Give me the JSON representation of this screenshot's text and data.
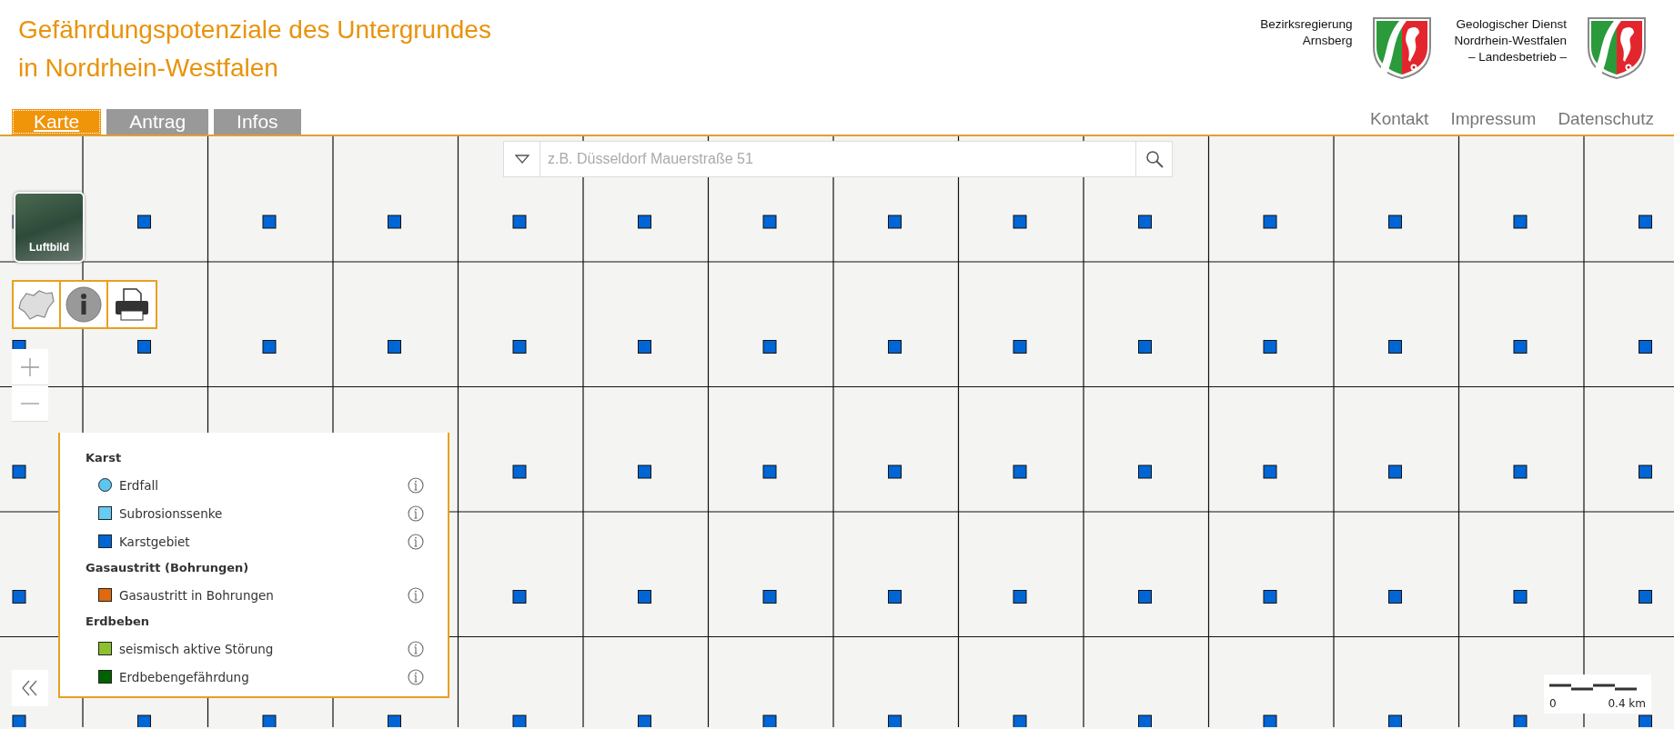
{
  "header": {
    "title_lines": [
      "Gefährdungspotenziale des Untergrundes",
      "in Nordrhein-Westfalen"
    ],
    "organizations": [
      {
        "lines": [
          "Bezirksregierung",
          "Arnsberg"
        ]
      },
      {
        "lines": [
          "Geologischer Dienst",
          "Nordrhein-Westfalen",
          "– Landesbetrieb –"
        ]
      }
    ]
  },
  "tabs": [
    {
      "label": "Karte",
      "selected": true
    },
    {
      "label": "Antrag",
      "selected": false
    },
    {
      "label": "Infos",
      "selected": false
    }
  ],
  "links": [
    "Kontakt",
    "Impressum",
    "Datenschutz"
  ],
  "search": {
    "placeholder": "z.B. Düsseldorf Mauerstraße 51"
  },
  "basemap_button": {
    "label": "Luftbild"
  },
  "legend": {
    "groups": [
      {
        "title": "Karst",
        "items": [
          {
            "label": "Erdfall",
            "kind": "circle",
            "color": "#5cc6ee"
          },
          {
            "label": "Subrosionssenke",
            "kind": "square",
            "color": "#66ccf2"
          },
          {
            "label": "Karstgebiet",
            "kind": "square",
            "color": "#0066d6"
          }
        ]
      },
      {
        "title": "Gasaustritt (Bohrungen)",
        "items": [
          {
            "label": "Gasaustritt in Bohrungen",
            "kind": "square",
            "color": "#e0680f"
          }
        ]
      },
      {
        "title": "Erdbeben",
        "items": [
          {
            "label": "seismisch aktive Störung",
            "kind": "square",
            "color": "#8cc02c"
          },
          {
            "label": "Erdbebengefährdung",
            "kind": "square",
            "color": "#006100"
          }
        ]
      }
    ]
  },
  "scale_bar": {
    "start": "0",
    "end": "0.4 km"
  }
}
